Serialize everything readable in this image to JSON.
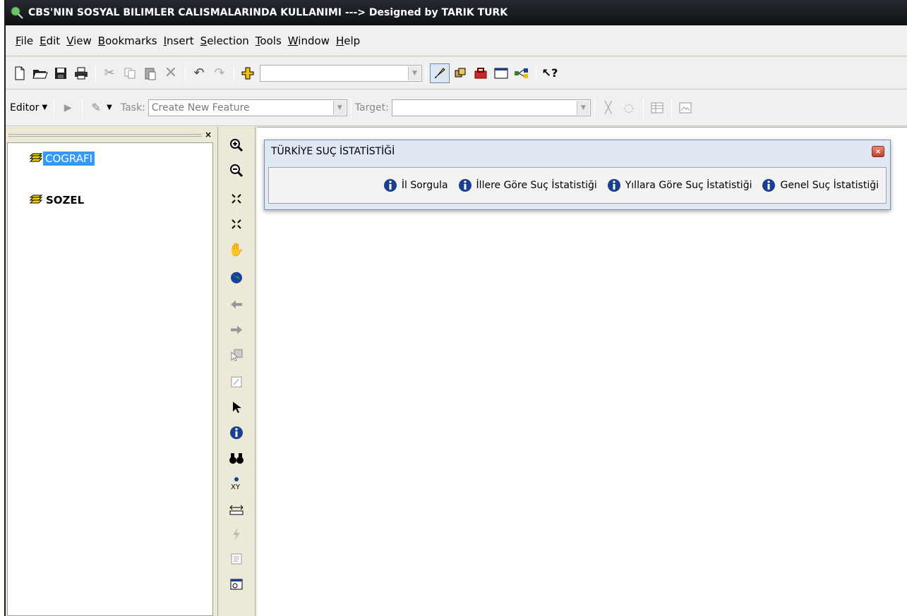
{
  "title": "CBS'NIN SOSYAL BILIMLER CALISMALARINDA KULLANIMI ---> Designed by TARIK TURK",
  "menu": {
    "items": [
      {
        "mn": "F",
        "rest": "ile"
      },
      {
        "mn": "E",
        "rest": "dit"
      },
      {
        "mn": "V",
        "rest": "iew"
      },
      {
        "mn": "B",
        "rest": "ookmarks"
      },
      {
        "mn": "I",
        "rest": "nsert"
      },
      {
        "mn": "S",
        "rest": "election"
      },
      {
        "mn": "T",
        "rest": "ools"
      },
      {
        "mn": "W",
        "rest": "indow"
      },
      {
        "mn": "H",
        "rest": "elp"
      }
    ]
  },
  "editor": {
    "editor_label": "Editor",
    "task_label": "Task:",
    "task_value": "Create New Feature",
    "target_label": "Target:",
    "target_value": ""
  },
  "toc": {
    "layers": [
      {
        "name": "COGRAFI",
        "selected": true
      },
      {
        "name": "SOZEL",
        "selected": false
      }
    ]
  },
  "floating_toolbar": {
    "title": "TÜRKİYE SUÇ İSTATİSTİĞİ",
    "buttons": [
      {
        "label": "İl Sorgula"
      },
      {
        "label": "İllere Göre Suç İstatistiği"
      },
      {
        "label": "Yıllara Göre Suç İstatistiği"
      },
      {
        "label": "Genel Suç İstatistiği"
      }
    ]
  },
  "colors": {
    "titlebar": "#1a1d22",
    "selection": "#3399ff",
    "info_icon": "#1a3f8f"
  }
}
